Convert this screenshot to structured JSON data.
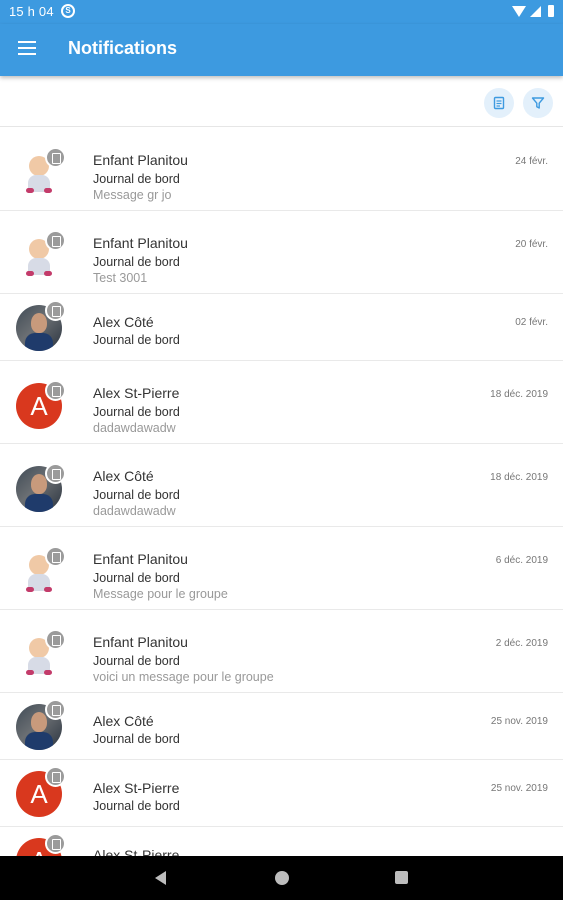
{
  "status_bar": {
    "time": "15 h 04",
    "sync_glyph": "S"
  },
  "app_bar": {
    "title": "Notifications",
    "color": "#3d9ae0"
  },
  "toolbar": {
    "icons": [
      "document-icon",
      "filter-icon"
    ]
  },
  "notifications": [
    {
      "name": "Enfant Planitou",
      "type": "Journal de bord",
      "message": "Message gr jo",
      "date": "24 févr.",
      "avatar": "baby"
    },
    {
      "name": "Enfant Planitou",
      "type": "Journal de bord",
      "message": "Test 3001",
      "date": "20 févr.",
      "avatar": "baby"
    },
    {
      "name": "Alex Côté",
      "type": "Journal de bord",
      "message": "",
      "date": "02 févr.",
      "avatar": "photo"
    },
    {
      "name": "Alex St-Pierre",
      "type": "Journal de bord",
      "message": "dadawdawadw",
      "date": "18 déc. 2019",
      "avatar": "letter",
      "letter": "A"
    },
    {
      "name": "Alex Côté",
      "type": "Journal de bord",
      "message": "dadawdawadw",
      "date": "18 déc. 2019",
      "avatar": "photo"
    },
    {
      "name": "Enfant Planitou",
      "type": "Journal de bord",
      "message": "Message pour le groupe",
      "date": "6 déc. 2019",
      "avatar": "baby"
    },
    {
      "name": "Enfant Planitou",
      "type": "Journal de bord",
      "message": "voici un message pour le groupe",
      "date": "2 déc. 2019",
      "avatar": "baby"
    },
    {
      "name": "Alex Côté",
      "type": "Journal de bord",
      "message": "",
      "date": "25 nov. 2019",
      "avatar": "photo"
    },
    {
      "name": "Alex St-Pierre",
      "type": "Journal de bord",
      "message": "",
      "date": "25 nov. 2019",
      "avatar": "letter",
      "letter": "A"
    },
    {
      "name": "Alex St-Pierre",
      "type": "",
      "message": "",
      "date": "",
      "avatar": "letter",
      "letter": "A"
    }
  ],
  "colors": {
    "accent": "#3d9ae0",
    "letter_avatar": "#d9381e",
    "badge": "#9b9b9b"
  }
}
